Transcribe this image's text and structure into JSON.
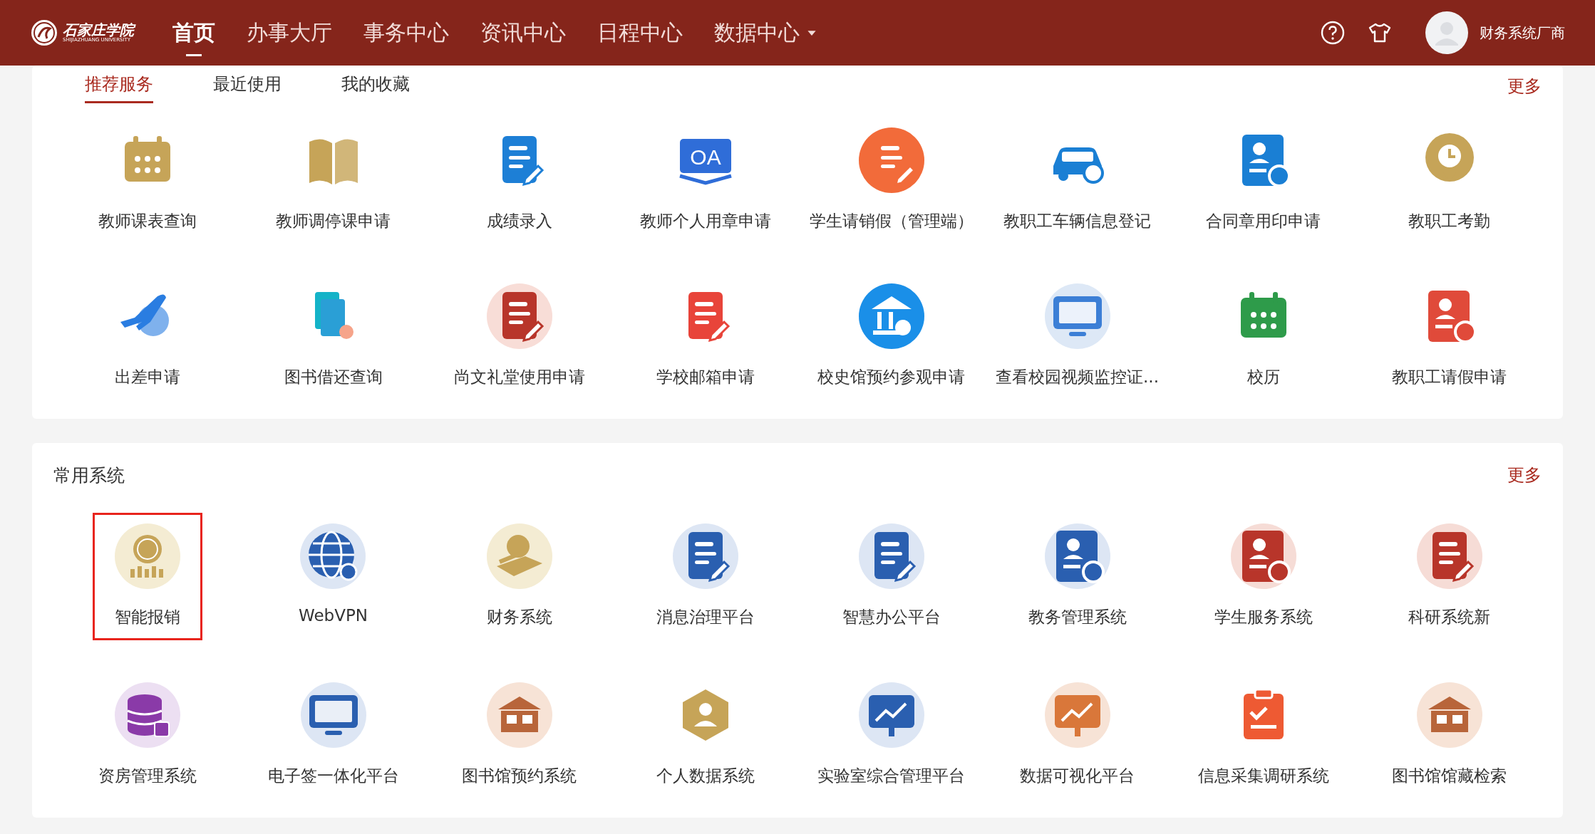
{
  "header": {
    "logo": {
      "name": "石家庄学院",
      "subtitle": "SHIJIAZHUANG UNIVERSITY"
    },
    "nav": [
      {
        "label": "首页",
        "selected": true,
        "dropdown": false
      },
      {
        "label": "办事大厅",
        "selected": false,
        "dropdown": false
      },
      {
        "label": "事务中心",
        "selected": false,
        "dropdown": false
      },
      {
        "label": "资讯中心",
        "selected": false,
        "dropdown": false
      },
      {
        "label": "日程中心",
        "selected": false,
        "dropdown": false
      },
      {
        "label": "数据中心",
        "selected": false,
        "dropdown": true
      }
    ],
    "user": {
      "name": "财务系统厂商"
    }
  },
  "services": {
    "tabs": [
      {
        "label": "推荐服务",
        "selected": true
      },
      {
        "label": "最近使用",
        "selected": false
      },
      {
        "label": "我的收藏",
        "selected": false
      }
    ],
    "more": "更多",
    "items": [
      {
        "label": "教师课表查询"
      },
      {
        "label": "教师调停课申请"
      },
      {
        "label": "成绩录入"
      },
      {
        "label": "教师个人用章申请",
        "icon_text": "OA"
      },
      {
        "label": "学生请销假（管理端）"
      },
      {
        "label": "教职工车辆信息登记"
      },
      {
        "label": "合同章用印申请"
      },
      {
        "label": "教职工考勤"
      },
      {
        "label": "出差申请"
      },
      {
        "label": "图书借还查询"
      },
      {
        "label": "尚文礼堂使用申请"
      },
      {
        "label": "学校邮箱申请"
      },
      {
        "label": "校史馆预约参观申请"
      },
      {
        "label": "查看校园视频监控证..."
      },
      {
        "label": "校历"
      },
      {
        "label": "教职工请假申请"
      }
    ]
  },
  "systems": {
    "title": "常用系统",
    "more": "更多",
    "items": [
      {
        "label": "智能报销",
        "selected": true
      },
      {
        "label": "WebVPN",
        "selected": false
      },
      {
        "label": "财务系统",
        "selected": false
      },
      {
        "label": "消息治理平台",
        "selected": false
      },
      {
        "label": "智慧办公平台",
        "selected": false
      },
      {
        "label": "教务管理系统",
        "selected": false
      },
      {
        "label": "学生服务系统",
        "selected": false
      },
      {
        "label": "科研系统新",
        "selected": false
      },
      {
        "label": "资房管理系统",
        "selected": false
      },
      {
        "label": "电子签一体化平台",
        "selected": false
      },
      {
        "label": "图书馆预约系统",
        "selected": false
      },
      {
        "label": "个人数据系统",
        "selected": false
      },
      {
        "label": "实验室综合管理平台",
        "selected": false
      },
      {
        "label": "数据可视化平台",
        "selected": false
      },
      {
        "label": "信息采集调研系统",
        "selected": false
      },
      {
        "label": "图书馆馆藏检索",
        "selected": false
      }
    ]
  }
}
